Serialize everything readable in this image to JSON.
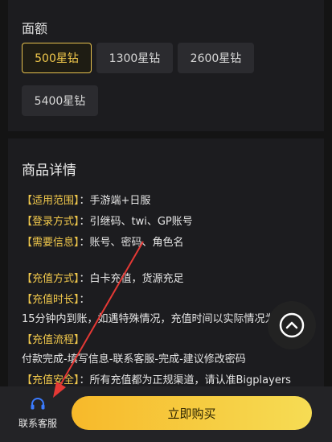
{
  "denomination": {
    "title": "面额",
    "options": [
      {
        "label": "500星钻",
        "selected": true
      },
      {
        "label": "1300星钻",
        "selected": false
      },
      {
        "label": "2600星钻",
        "selected": false
      },
      {
        "label": "5400星钻",
        "selected": false
      }
    ]
  },
  "details": {
    "title": "商品详情",
    "lines": [
      {
        "key": "【适用范围】",
        "value": "：手游端+日服"
      },
      {
        "key": "【登录方式】",
        "value": "：引继码、twi、GP账号"
      },
      {
        "key": "【需要信息】",
        "value": "：账号、密码、角色名"
      },
      {
        "key": "【充值方式】",
        "value": "：白卡充值，货源充足"
      },
      {
        "key": "【充值时长】",
        "value": "："
      },
      {
        "key": "",
        "value": "15分钟内到账，如遇特殊情况，充值时间以实际情况为"
      },
      {
        "key": "【充值流程】",
        "value": ""
      },
      {
        "key": "",
        "value": "付款完成-填写信息-联系客服-完成-建议修改密码"
      },
      {
        "key": "【充值安全】",
        "value": "：所有充值都为正规渠道，请认准Bigplayers"
      }
    ]
  },
  "bottom_bar": {
    "customer_service_label": "联系客服",
    "buy_label": "立即购买"
  },
  "colors": {
    "accent": "#f2c94c",
    "annotation_arrow": "#e53935",
    "cs_icon": "#3a7bff"
  },
  "icons": [
    "headset-icon",
    "chevron-up-icon"
  ]
}
